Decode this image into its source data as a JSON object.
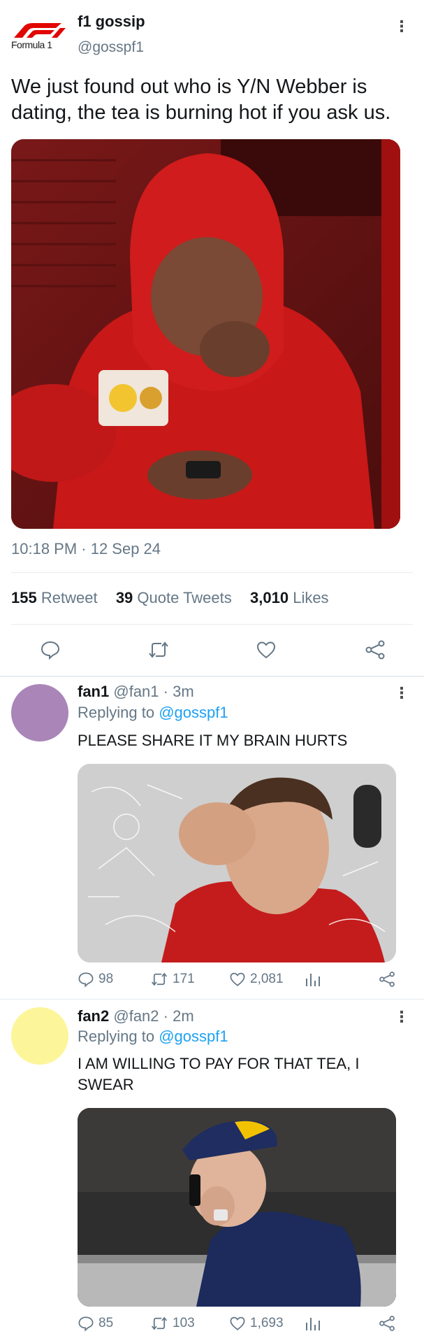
{
  "main_tweet": {
    "logo_text": "Formula 1",
    "display_name": "f1 gossip",
    "handle": "@gosspf1",
    "text": "We just found out who is Y/N Webber is dating, the tea is burning hot if you ask us.",
    "media_icon": "photo-man-in-red-hoodie-looking-at-phone",
    "timestamp": "10:18 PM · 12 Sep 24",
    "stats": {
      "retweets_count": "155",
      "retweets_label": "Retweet",
      "quotes_count": "39",
      "quotes_label": "Quote Tweets",
      "likes_count": "3,010",
      "likes_label": "Likes"
    }
  },
  "replies": [
    {
      "display_name": "fan1",
      "handle": "@fan1",
      "time": "· 3m",
      "replying_prefix": "Replying to",
      "replying_handle": "@gosspf1",
      "text": "PLEASE SHARE IT MY BRAIN HURTS",
      "avatar_color": "#a985b8",
      "media_icon": "photo-confused-math-meme",
      "counts": {
        "replies": "98",
        "retweets": "171",
        "likes": "2,081"
      }
    },
    {
      "display_name": "fan2",
      "handle": "@fan2",
      "time": "· 2m",
      "replying_prefix": "Replying to",
      "replying_handle": "@gosspf1",
      "text": "I AM WILLING TO PAY FOR THAT TEA, I SWEAR",
      "avatar_color": "#fdf59a",
      "media_icon": "photo-man-on-phone-call",
      "counts": {
        "replies": "85",
        "retweets": "103",
        "likes": "1,693"
      }
    }
  ],
  "colors": {
    "link": "#1da1f2",
    "secondary_text": "#657786",
    "divider": "#e6ecf0",
    "f1_red": "#e10600"
  }
}
